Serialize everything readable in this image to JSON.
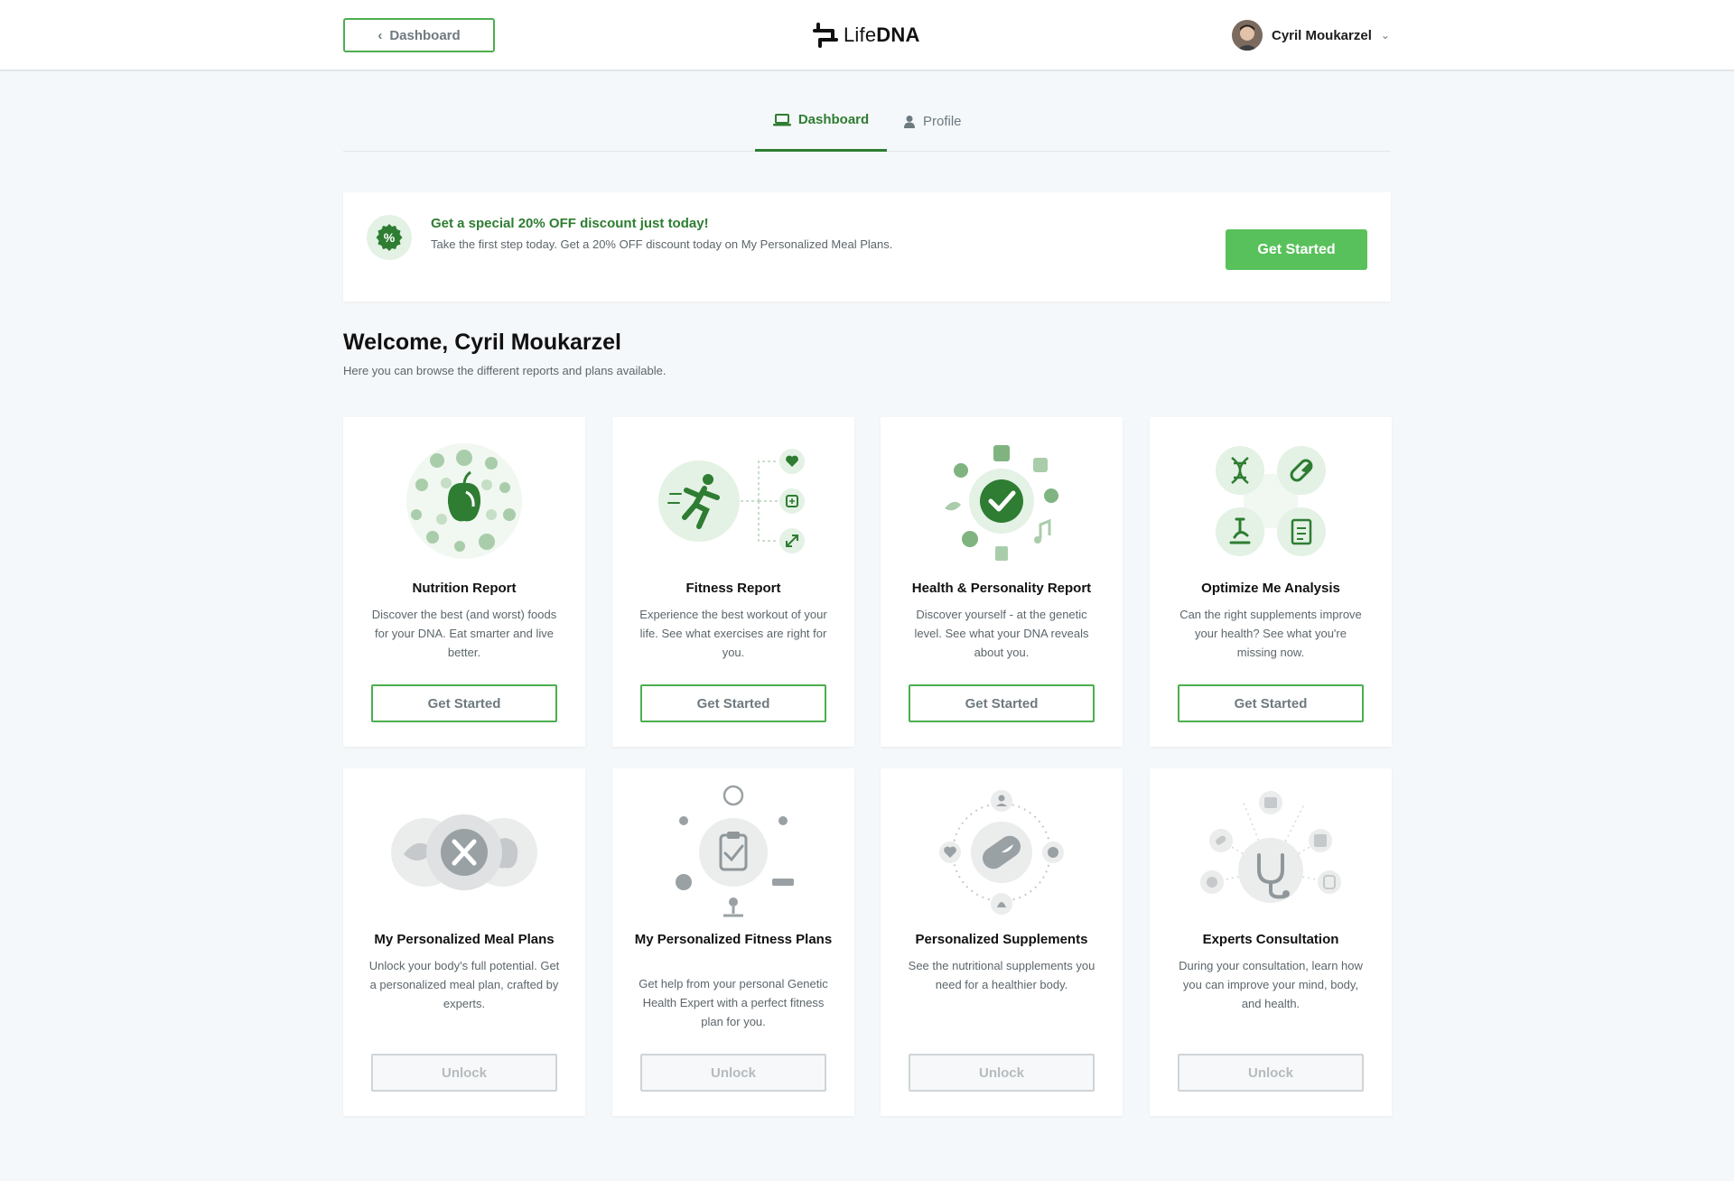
{
  "header": {
    "back_label": "Dashboard",
    "logo_text_light": "Life",
    "logo_text_bold": "DNA",
    "user_name": "Cyril Moukarzel"
  },
  "tabs": [
    {
      "label": "Dashboard",
      "icon": "laptop-icon",
      "active": true
    },
    {
      "label": "Profile",
      "icon": "user-icon",
      "active": false
    }
  ],
  "promo": {
    "title": "Get a special 20% OFF discount just today!",
    "description": "Take the first step today. Get a 20% OFF discount today on My Personalized Meal Plans.",
    "button": "Get Started",
    "badge_icon": "percent-badge-icon"
  },
  "welcome": {
    "title": "Welcome, Cyril Moukarzel",
    "subtitle": "Here you can browse the different reports and plans available."
  },
  "reports": [
    {
      "title": "Nutrition Report",
      "description": "Discover the best (and worst) foods for your DNA. Eat smarter and live better.",
      "button": "Get Started",
      "icon": "nutrition-illustration-icon"
    },
    {
      "title": "Fitness Report",
      "description": "Experience the best workout of your life. See what exercises are right for you.",
      "button": "Get Started",
      "icon": "fitness-illustration-icon"
    },
    {
      "title": "Health & Personality Report",
      "description": "Discover yourself - at the genetic level. See what your DNA reveals about you.",
      "button": "Get Started",
      "icon": "health-illustration-icon"
    },
    {
      "title": "Optimize Me Analysis",
      "description": "Can the right supplements improve your health? See what you're missing now.",
      "button": "Get Started",
      "icon": "optimize-illustration-icon"
    }
  ],
  "plans": [
    {
      "title": "My Personalized Meal Plans",
      "description": "Unlock your body's full potential. Get a personalized meal plan, crafted by experts.",
      "button": "Unlock",
      "icon": "meal-plan-illustration-icon"
    },
    {
      "title": "My Personalized Fitness Plans",
      "description": "Get help from your personal Genetic Health Expert with a perfect fitness plan for you.",
      "button": "Unlock",
      "icon": "fitness-plan-illustration-icon"
    },
    {
      "title": "Personalized Supplements",
      "description": "See the nutritional supplements you need for a healthier body.",
      "button": "Unlock",
      "icon": "supplements-illustration-icon"
    },
    {
      "title": "Experts Consultation",
      "description": "During your consultation, learn how you can improve your mind, body, and health.",
      "button": "Unlock",
      "icon": "consultation-illustration-icon"
    }
  ],
  "colors": {
    "brand_green": "#2e7d32",
    "button_green": "#58c15b",
    "outline_green": "#4cae4f",
    "background": "#f5f8fa"
  }
}
